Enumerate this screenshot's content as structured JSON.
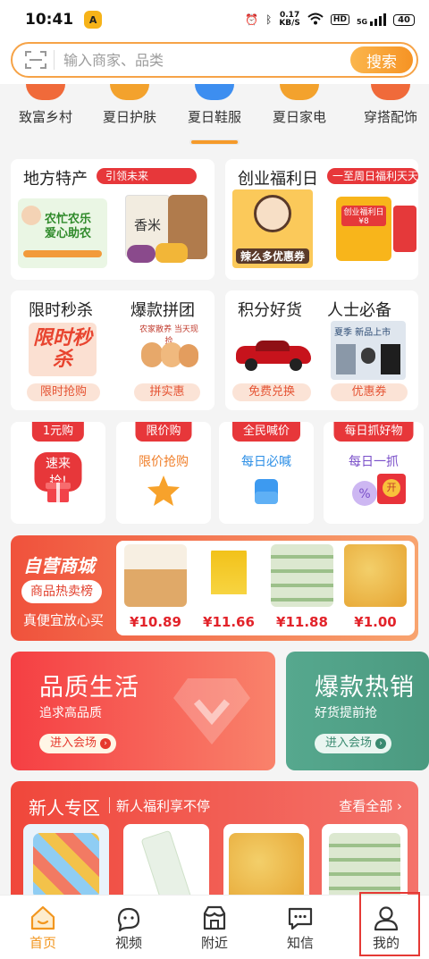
{
  "status_bar": {
    "time": "10:41",
    "app_badge": "A",
    "net_speed_top": "0.17",
    "net_speed_bottom": "KB/S",
    "hd": "HD",
    "signal": "5G",
    "battery": "40"
  },
  "search": {
    "placeholder": "输入商家、品类",
    "button_label": "搜索"
  },
  "categories": [
    {
      "label": "致富乡村",
      "color": "#f06a3a"
    },
    {
      "label": "夏日护肤",
      "color": "#f3a22d"
    },
    {
      "label": "夏日鞋服",
      "color": "#3d8ef0"
    },
    {
      "label": "夏日家电",
      "color": "#f3a22d"
    },
    {
      "label": "穿搭配饰",
      "color": "#f06a3a"
    }
  ],
  "promo_row1": [
    {
      "title": "地方特产",
      "tag": "引领未来",
      "image_text": "农忙农乐 爱心助农",
      "badge": "香米"
    },
    {
      "title": "创业福利日",
      "tag": "一至周日福利天天",
      "image_text": "辣么多优惠券",
      "bag_text": "创业福利日 ¥8"
    }
  ],
  "promo_row2": [
    {
      "title": "限时秒杀",
      "button": "限时抢购",
      "image_text": "限时秒杀"
    },
    {
      "title": "爆款拼团",
      "button": "拼实惠",
      "image_text": "农家散养 当天现捡"
    },
    {
      "title": "积分好货",
      "button": "免费兑换"
    },
    {
      "title": "人士必备",
      "button": "优惠券",
      "image_text": "夏季 新品上市"
    }
  ],
  "mini_cards": [
    {
      "tag": "1元购",
      "sub": "速来抢!"
    },
    {
      "tag": "限价购",
      "sub": "限价抢购"
    },
    {
      "tag": "全民喊价",
      "sub": "每日必喊"
    },
    {
      "tag": "每日抓好物",
      "sub": "每日一抓"
    }
  ],
  "self_mall": {
    "title": "自营商城",
    "pill": "商品热卖榜",
    "sub": "真便宜放心买",
    "goods": [
      {
        "price": "¥10.89"
      },
      {
        "price": "¥11.66"
      },
      {
        "price": "¥11.88"
      },
      {
        "price": "¥1.00"
      }
    ]
  },
  "banners": [
    {
      "title": "品质生活",
      "sub": "追求高品质",
      "button": "进入会场"
    },
    {
      "title": "爆款热销",
      "sub": "好货提前抢",
      "button": "进入会场"
    }
  ],
  "new_user": {
    "title": "新人专区",
    "sub": "新人福利享不停",
    "view_all": "查看全部"
  },
  "bottom_nav": [
    {
      "label": "首页"
    },
    {
      "label": "视频"
    },
    {
      "label": "附近"
    },
    {
      "label": "知信"
    },
    {
      "label": "我的"
    }
  ]
}
